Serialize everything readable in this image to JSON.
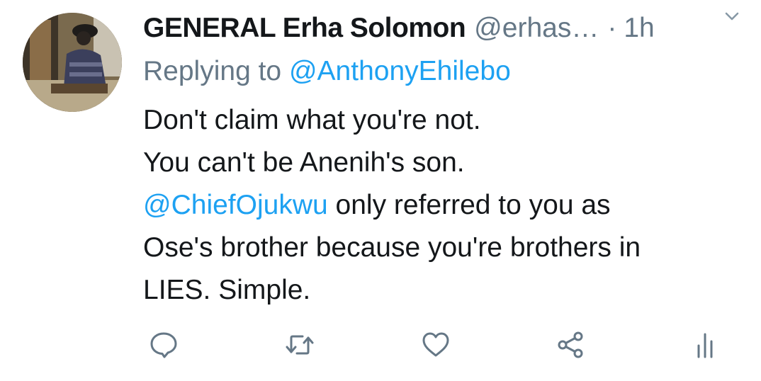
{
  "tweet": {
    "display_name": "GENERAL Erha Solomon",
    "handle": "@erhas…",
    "separator": "·",
    "time": "1h",
    "replying_prefix": "Replying to ",
    "replying_to": "@AnthonyEhilebo",
    "lines": {
      "l1": "Don't claim what you're not.",
      "l2": "You can't be Anenih's son.",
      "l3_mention": "@ChiefOjukwu",
      "l3_rest": " only referred to you as",
      "l4": "Ose's brother because you're brothers in",
      "l5": "LIES. Simple."
    }
  },
  "icons": {
    "more": "chevron-down-icon",
    "reply": "reply-bubble-icon",
    "retweet": "retweet-icon",
    "like": "heart-icon",
    "share": "share-icon",
    "analytics": "analytics-icon"
  },
  "colors": {
    "text": "#14171a",
    "secondary": "#657786",
    "link": "#1da1f2"
  }
}
